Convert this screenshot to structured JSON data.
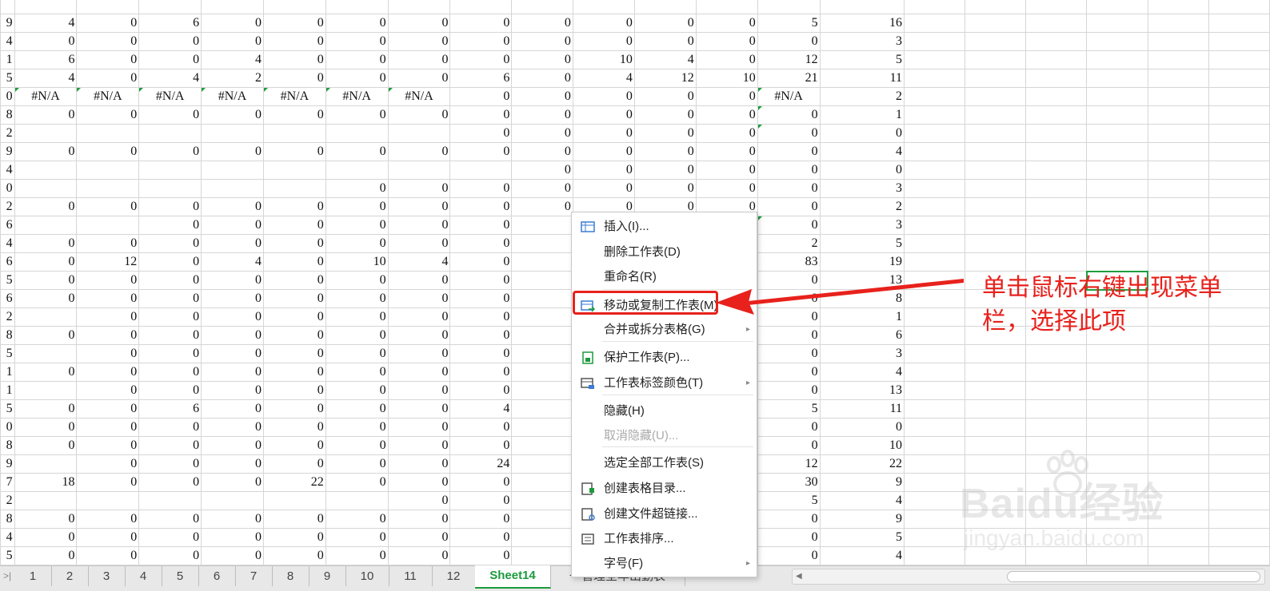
{
  "rows": [
    [
      "9",
      "4",
      "0",
      "6",
      "0",
      "0",
      "0",
      "0",
      "0",
      "0",
      "0",
      "0",
      "0",
      "5",
      "16"
    ],
    [
      "4",
      "0",
      "0",
      "0",
      "0",
      "0",
      "0",
      "0",
      "0",
      "0",
      "0",
      "0",
      "0",
      "0",
      "3"
    ],
    [
      "1",
      "6",
      "0",
      "0",
      "4",
      "0",
      "0",
      "0",
      "0",
      "0",
      "10",
      "4",
      "0",
      "12",
      "5"
    ],
    [
      "5",
      "4",
      "0",
      "4",
      "2",
      "0",
      "0",
      "0",
      "6",
      "0",
      "4",
      "12",
      "10",
      "21",
      "11"
    ],
    [
      "0",
      "#N/A",
      "#N/A",
      "#N/A",
      "#N/A",
      "#N/A",
      "#N/A",
      "#N/A",
      "0",
      "0",
      "0",
      "0",
      "0",
      "#N/A",
      "2"
    ],
    [
      "8",
      "0",
      "0",
      "0",
      "0",
      "0",
      "0",
      "0",
      "0",
      "0",
      "0",
      "0",
      "0",
      "0",
      "1"
    ],
    [
      "2",
      "",
      "",
      "",
      "",
      "",
      "",
      "",
      "0",
      "0",
      "0",
      "0",
      "0",
      "0",
      "0"
    ],
    [
      "9",
      "0",
      "0",
      "0",
      "0",
      "0",
      "0",
      "0",
      "0",
      "0",
      "0",
      "0",
      "0",
      "0",
      "4"
    ],
    [
      "4",
      "",
      "",
      "",
      "",
      "",
      "",
      "",
      "",
      "0",
      "0",
      "0",
      "0",
      "0",
      "0"
    ],
    [
      "0",
      "",
      "",
      "",
      "",
      "",
      "0",
      "0",
      "0",
      "0",
      "0",
      "0",
      "0",
      "0",
      "3"
    ],
    [
      "2",
      "0",
      "0",
      "0",
      "0",
      "0",
      "0",
      "0",
      "0",
      "0",
      "0",
      "0",
      "0",
      "0",
      "2"
    ],
    [
      "6",
      "",
      "",
      "0",
      "0",
      "0",
      "0",
      "0",
      "0",
      "",
      "",
      "",
      "0",
      "0",
      "3"
    ],
    [
      "4",
      "0",
      "0",
      "0",
      "0",
      "0",
      "0",
      "0",
      "0",
      "",
      "",
      "",
      "0",
      "2",
      "5"
    ],
    [
      "6",
      "0",
      "12",
      "0",
      "4",
      "0",
      "10",
      "4",
      "0",
      "",
      "",
      "",
      "48",
      "83",
      "19"
    ],
    [
      "5",
      "0",
      "0",
      "0",
      "0",
      "0",
      "0",
      "0",
      "0",
      "",
      "",
      "",
      "0",
      "0",
      "13"
    ],
    [
      "6",
      "0",
      "0",
      "0",
      "0",
      "0",
      "0",
      "0",
      "0",
      "",
      "",
      "",
      "0",
      "0",
      "8"
    ],
    [
      "2",
      "",
      "0",
      "0",
      "0",
      "0",
      "0",
      "0",
      "0",
      "",
      "",
      "",
      "0",
      "0",
      "1"
    ],
    [
      "8",
      "0",
      "0",
      "0",
      "0",
      "0",
      "0",
      "0",
      "0",
      "",
      "",
      "",
      "0",
      "0",
      "6"
    ],
    [
      "5",
      "",
      "0",
      "0",
      "0",
      "0",
      "0",
      "0",
      "0",
      "",
      "",
      "",
      "0",
      "0",
      "3"
    ],
    [
      "1",
      "0",
      "0",
      "0",
      "0",
      "0",
      "0",
      "0",
      "0",
      "",
      "",
      "",
      "0",
      "0",
      "4"
    ],
    [
      "1",
      "",
      "0",
      "0",
      "0",
      "0",
      "0",
      "0",
      "0",
      "",
      "",
      "",
      "0",
      "0",
      "13"
    ],
    [
      "5",
      "0",
      "0",
      "6",
      "0",
      "0",
      "0",
      "0",
      "4",
      "",
      "",
      "",
      "0",
      "5",
      "11"
    ],
    [
      "0",
      "0",
      "0",
      "0",
      "0",
      "0",
      "0",
      "0",
      "0",
      "",
      "",
      "",
      "0",
      "0",
      "0"
    ],
    [
      "8",
      "0",
      "0",
      "0",
      "0",
      "0",
      "0",
      "0",
      "0",
      "",
      "",
      "",
      "0",
      "0",
      "10"
    ],
    [
      "9",
      "",
      "0",
      "0",
      "0",
      "0",
      "0",
      "0",
      "24",
      "",
      "",
      "",
      "0",
      "12",
      "22"
    ],
    [
      "7",
      "18",
      "0",
      "0",
      "0",
      "22",
      "0",
      "0",
      "0",
      "",
      "",
      "",
      "4",
      "30",
      "9"
    ],
    [
      "2",
      "",
      "",
      "",
      "",
      "",
      "",
      "0",
      "0",
      "",
      "",
      "",
      "0",
      "5",
      "4"
    ],
    [
      "8",
      "0",
      "0",
      "0",
      "0",
      "0",
      "0",
      "0",
      "0",
      "",
      "",
      "",
      "0",
      "0",
      "9"
    ],
    [
      "4",
      "0",
      "0",
      "0",
      "0",
      "0",
      "0",
      "0",
      "0",
      "",
      "",
      "",
      "0",
      "0",
      "5"
    ],
    [
      "5",
      "0",
      "0",
      "0",
      "0",
      "0",
      "0",
      "0",
      "0",
      "",
      "",
      "",
      "0",
      "0",
      "4"
    ]
  ],
  "tabs": [
    "1",
    "2",
    "3",
    "4",
    "5",
    "6",
    "7",
    "8",
    "9",
    "10",
    "11",
    "12",
    "Sheet14",
    "一管理全年出勤表"
  ],
  "active_tab": "Sheet14",
  "context_menu": {
    "items": [
      {
        "label": "插入(I)...",
        "icon": "insert-sheet-icon"
      },
      {
        "label": "删除工作表(D)"
      },
      {
        "label": "重命名(R)"
      },
      {
        "label": "移动或复制工作表(M)",
        "icon": "move-copy-icon"
      },
      {
        "label": "合并或拆分表格(G)",
        "submenu": true
      },
      {
        "label": "保护工作表(P)...",
        "icon": "protect-sheet-icon"
      },
      {
        "label": "工作表标签颜色(T)",
        "icon": "tab-color-icon",
        "submenu": true
      },
      {
        "label": "隐藏(H)"
      },
      {
        "label": "取消隐藏(U)...",
        "disabled": true
      },
      {
        "label": "选定全部工作表(S)"
      },
      {
        "label": "创建表格目录...",
        "icon": "table-directory-icon"
      },
      {
        "label": "创建文件超链接...",
        "icon": "hyperlink-icon"
      },
      {
        "label": "工作表排序...",
        "icon": "sort-sheets-icon"
      },
      {
        "label": "字号(F)",
        "submenu": true
      }
    ]
  },
  "annotation": {
    "text": "单击鼠标右键出现菜单栏，选择此项",
    "color": "#e8211c"
  },
  "watermark": {
    "logo": "Baidu经验",
    "url": "jingyan.baidu.com"
  },
  "colors": {
    "accent": "#1c9a3c",
    "annotation": "#e8211c"
  }
}
